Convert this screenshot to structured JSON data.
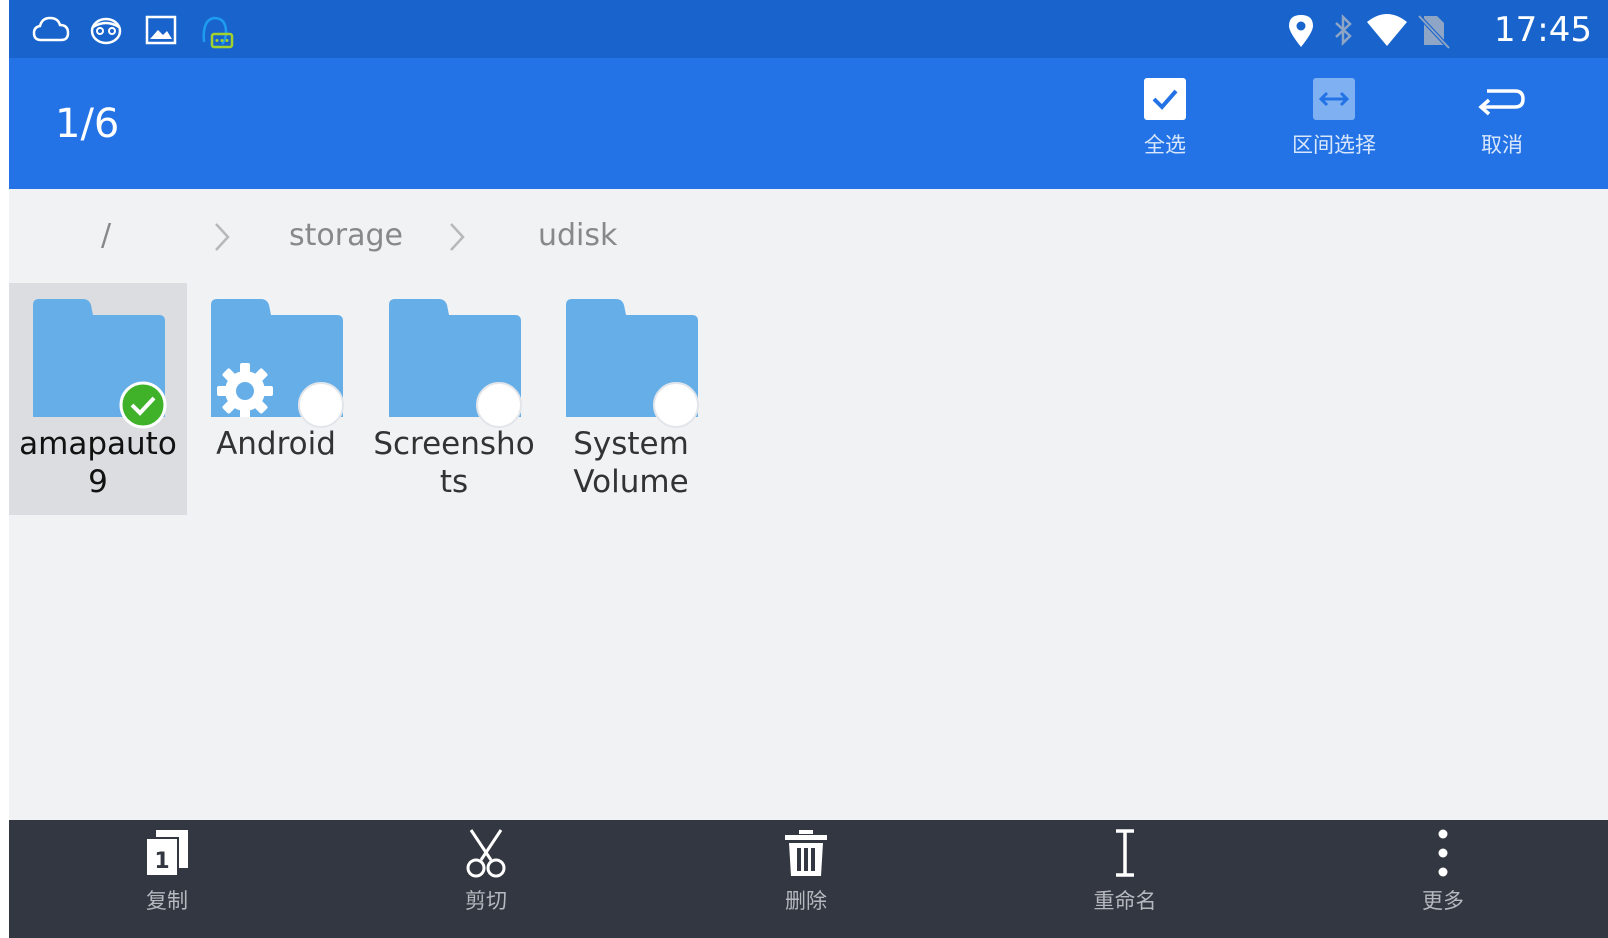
{
  "status_bar": {
    "time": "17:45",
    "left_icons": [
      "weather-icon",
      "face-icon",
      "gallery-icon",
      "message-icon"
    ],
    "right_icons": [
      "location-icon",
      "bluetooth-icon",
      "wifi-icon",
      "no-sim-icon"
    ]
  },
  "action_bar": {
    "selection_count": "1/6",
    "select_all_label": "全选",
    "range_select_label": "区间选择",
    "cancel_label": "取消"
  },
  "breadcrumb": {
    "items": [
      "/",
      "storage",
      "udisk"
    ]
  },
  "files": [
    {
      "name_line1": "amapauto",
      "name_line2": "9",
      "selected": true,
      "icon": "folder-icon"
    },
    {
      "name_line1": "Android",
      "name_line2": "",
      "selected": false,
      "icon": "folder-gear-icon"
    },
    {
      "name_line1": "Screensho",
      "name_line2": "ts",
      "selected": false,
      "icon": "folder-icon"
    },
    {
      "name_line1": "System",
      "name_line2": "Volume",
      "selected": false,
      "icon": "folder-icon"
    }
  ],
  "bottom_bar": {
    "copy_label": "复制",
    "cut_label": "剪切",
    "delete_label": "删除",
    "rename_label": "重命名",
    "more_label": "更多"
  },
  "colors": {
    "status_bar": "#1864cc",
    "action_bar": "#2373e6",
    "folder": "#66aee8",
    "check": "#3fb22a",
    "bottom_bar": "#333741"
  }
}
